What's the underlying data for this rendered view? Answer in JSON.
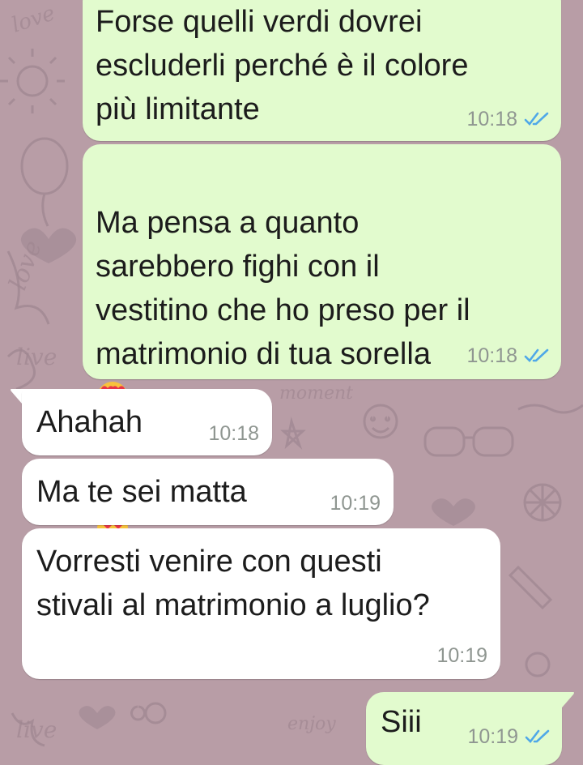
{
  "chat": {
    "theme": {
      "outgoing_bubble": "#e2fbce",
      "incoming_bubble": "#ffffff",
      "wallpaper": "#b89da6",
      "read_ticks": "#4fa8e8"
    },
    "messages": [
      {
        "direction": "outgoing",
        "text": "Forse quelli verdi dovrei\nescluderli perché è il colore\npiù limitante",
        "time": "10:18",
        "status": "read"
      },
      {
        "direction": "outgoing",
        "text": "Ma pensa a quanto\nsarebbero fighi con il\nvestitino che ho preso per il\nmatrimonio di tua sorella",
        "emoji": "heart-eyes-emoji",
        "time": "10:18",
        "status": "read"
      },
      {
        "direction": "incoming",
        "text": "Ahahah",
        "time": "10:18"
      },
      {
        "direction": "incoming",
        "text": "Ma te sei matta",
        "time": "10:19"
      },
      {
        "direction": "incoming",
        "text": "Vorresti venire con questi\nstivali al matrimonio a luglio?",
        "time": "10:19"
      },
      {
        "direction": "outgoing",
        "text": "Siii",
        "time": "10:19",
        "status": "read"
      }
    ]
  }
}
